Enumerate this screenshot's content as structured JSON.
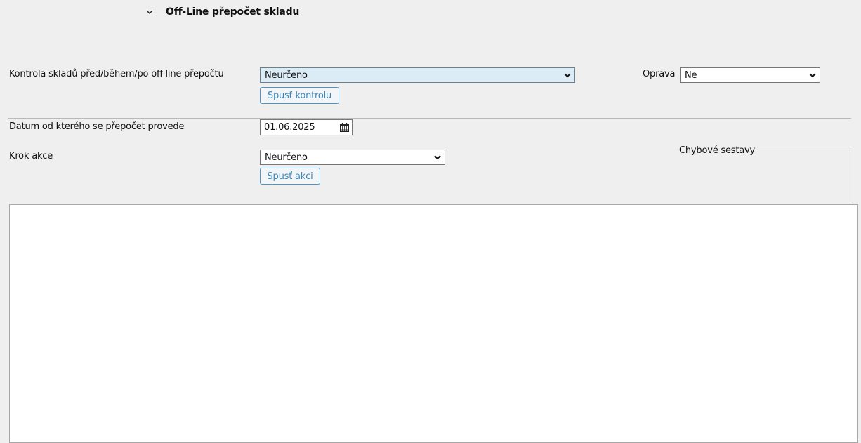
{
  "section": {
    "title": "Off-Line přepočet skladu",
    "expanded_icon": "chevron-down-icon"
  },
  "kontrola": {
    "label": "Kontrola skladů před/během/po off-line přepočtu",
    "selected": "Neurčeno",
    "button_label": "Spusť kontrolu"
  },
  "oprava": {
    "label": "Oprava",
    "selected": "Ne"
  },
  "datum": {
    "label": "Datum od kterého se přepočet provede",
    "value": "01.06.2025",
    "icon": "calendar-icon"
  },
  "krok": {
    "label": "Krok akce",
    "selected": "Neurčeno",
    "button_label": "Spusť akci"
  },
  "chybove_sestavy": {
    "legend": "Chybové sestavy"
  },
  "colors": {
    "background": "#efefef",
    "focused_select": "#dcecf6",
    "button_border": "#4c97c7",
    "button_text": "#3a86bb"
  }
}
